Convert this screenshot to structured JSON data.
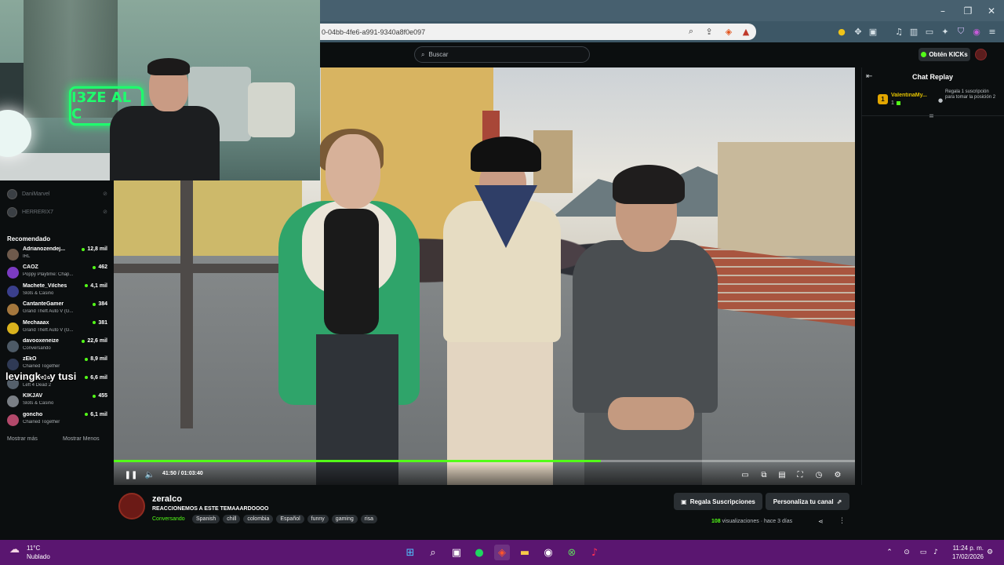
{
  "browser": {
    "url": "0-04bb-4fe6-a991-9340a8f0e097",
    "window_controls": [
      "–",
      "❐",
      "✕"
    ]
  },
  "header": {
    "search_placeholder": "Buscar",
    "kicks_button": "Obtén KICKs"
  },
  "sidebar": {
    "following": [
      {
        "name": "DaniMarvel"
      },
      {
        "name": "HERRERIX7"
      }
    ],
    "recommended_title": "Recomendado",
    "recommended": [
      {
        "name": "Adrianozendej...",
        "category": "IRL",
        "viewers": "12,8 mil",
        "color": "#6e5a4c"
      },
      {
        "name": "CAOZ",
        "category": "Poppy Playtime: Chap...",
        "viewers": "462",
        "color": "#7b3bc2"
      },
      {
        "name": "Machete_Vilches",
        "category": "Slots & Casino",
        "viewers": "4,1 mil",
        "color": "#3a3f8c"
      },
      {
        "name": "CantanteGamer",
        "category": "Grand Theft Auto V (G...",
        "viewers": "384",
        "color": "#a4773d"
      },
      {
        "name": "Mechaaax",
        "category": "Grand Theft Auto V (G...",
        "viewers": "381",
        "color": "#d9b21d"
      },
      {
        "name": "davooxeneize",
        "category": "Conversando",
        "viewers": "22,6 mil",
        "color": "#4d5a66"
      },
      {
        "name": "zEkO",
        "category": "Chained Together",
        "viewers": "8,9 mil",
        "color": "#2f3a55"
      },
      {
        "name": "Scariolexd",
        "category": "Left 4 Dead 2",
        "viewers": "6,6 mil",
        "color": "#55606b"
      },
      {
        "name": "KIKJAV",
        "category": "Slots & Casino",
        "viewers": "455",
        "color": "#7a7f85"
      },
      {
        "name": "goncho",
        "category": "Chained Together",
        "viewers": "6,1 mil",
        "color": "#b3496b"
      }
    ],
    "show_more": "Mostrar más",
    "show_less": "Mostrar Menos",
    "overlay_text": "levingk : y tusi"
  },
  "webcam": {
    "neon_sign": "I3ZE AL C"
  },
  "player": {
    "time": "41:50 / 01:03:40",
    "progress": 0.657,
    "accent": "#53fc18"
  },
  "chat": {
    "title": "Chat Replay",
    "pinned": {
      "badge": "1",
      "name": "ValentinaMy...",
      "count": "1",
      "description": "Regala 1 suscripción para tomar la posición 2"
    }
  },
  "stream": {
    "streamer": "zeralco",
    "title": "REACCIONEMOS A ESTE TEMAAARDOOOO",
    "category": "Conversando",
    "tags": [
      "Spanish",
      "chill",
      "colombia",
      "Español",
      "funny",
      "gaming",
      "risa"
    ],
    "gift_button": "Regala Suscripciones",
    "customize_button": "Personaliza tu canal",
    "views_count": "108",
    "views_label": "visualizaciones",
    "ago": "hace 3 días"
  },
  "taskbar": {
    "temp": "11°C",
    "weather": "Nublado",
    "time": "11:24 p. m.",
    "date": "17/02/2026"
  }
}
